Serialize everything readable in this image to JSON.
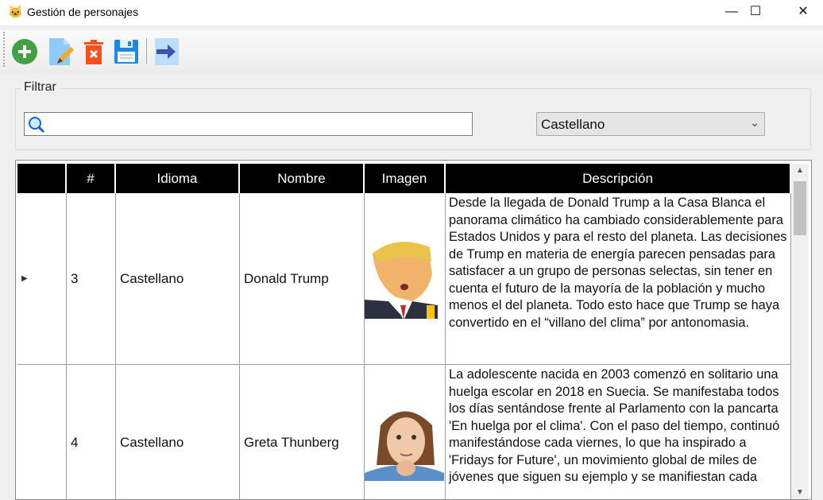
{
  "window": {
    "title": "Gestión de personajes",
    "app_icon": "pikachu-icon"
  },
  "toolbar": {
    "buttons": [
      {
        "name": "add",
        "icon": "plus-circle-icon"
      },
      {
        "name": "edit",
        "icon": "edit-document-icon"
      },
      {
        "name": "delete",
        "icon": "trash-icon"
      },
      {
        "name": "save",
        "icon": "floppy-icon"
      },
      {
        "name": "exit",
        "icon": "arrow-right-icon"
      }
    ]
  },
  "filter": {
    "label": "Filtrar",
    "search_value": "",
    "language": "Castellano"
  },
  "grid": {
    "headers": [
      "#",
      "Idioma",
      "Nombre",
      "Imagen",
      "Descripción"
    ],
    "rows": [
      {
        "id": "3",
        "idioma": "Castellano",
        "nombre": "Donald Trump",
        "descripcion": "Desde la llegada de Donald Trump a la Casa Blanca el panorama climático ha cambiado considerablemente para Estados Unidos y para el resto del planeta. Las decisiones de Trump en materia de energía parecen pensadas para satisfacer a un grupo de personas selectas, sin tener en cuenta el futuro de la mayoría de la población y mucho menos el del planeta. Todo esto hace que Trump se haya convertido en el “villano del clima” por antonomasia."
      },
      {
        "id": "4",
        "idioma": "Castellano",
        "nombre": "Greta Thunberg",
        "descripcion": "La adolescente nacida en 2003 comenzó en solitario una huelga escolar en 2018 en Suecia. Se manifestaba todos los días sentándose frente al Parlamento con la pancarta 'En huelga por el clima'. Con el paso del tiempo, continuó manifestándose cada viernes, lo que ha inspirado a 'Fridays for Future', un movimiento global de miles de jóvenes que siguen su ejemplo y se manifiestan cada"
      }
    ]
  }
}
